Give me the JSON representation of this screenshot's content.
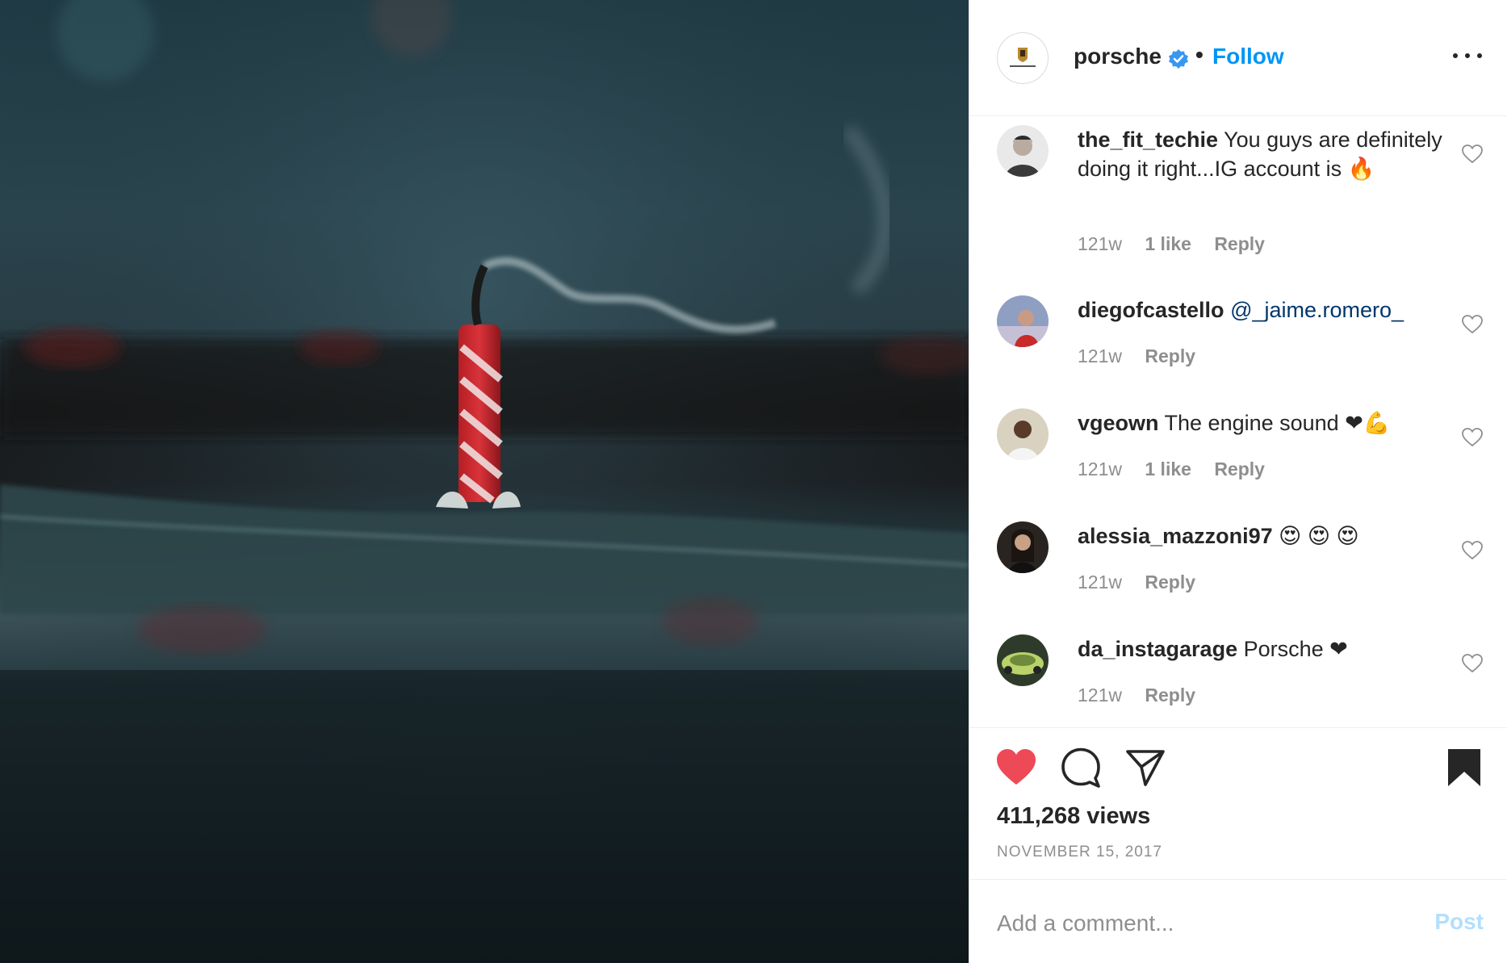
{
  "post": {
    "media_alt": "",
    "author": {
      "username": "porsche",
      "verified": true,
      "separator": "•",
      "follow_label": "Follow"
    },
    "comments": [
      {
        "username": "the_fit_techie",
        "text": "You guys are definitely doing it right...IG account is 🔥",
        "age": "121w",
        "likes": "1 like",
        "reply_label": "Reply"
      },
      {
        "username": "diegofcastello",
        "mention": "@_jaime.romero_",
        "text": "",
        "age": "121w",
        "likes": "",
        "reply_label": "Reply"
      },
      {
        "username": "vgeown",
        "text": "The engine sound ❤💪",
        "age": "121w",
        "likes": "1 like",
        "reply_label": "Reply"
      },
      {
        "username": "alessia_mazzoni97",
        "text": "😍 😍 😍",
        "age": "121w",
        "likes": "",
        "reply_label": "Reply"
      },
      {
        "username": "da_instagarage",
        "text": "Porsche ❤",
        "age": "121w",
        "likes": "",
        "reply_label": "Reply"
      }
    ],
    "actions": {
      "liked": true,
      "like_color": "#ed4956",
      "saved": true,
      "icons": [
        "heart-icon",
        "comment-icon",
        "share-icon",
        "bookmark-icon"
      ]
    },
    "views": "411,268 views",
    "date": "NOVEMBER 15, 2017",
    "add_comment": {
      "placeholder": "Add a comment...",
      "post_label": "Post"
    }
  },
  "colors": {
    "accent": "#0095f6",
    "mention": "#00376b",
    "meta": "#8e8e8e",
    "post_disabled": "#b2dffc"
  }
}
